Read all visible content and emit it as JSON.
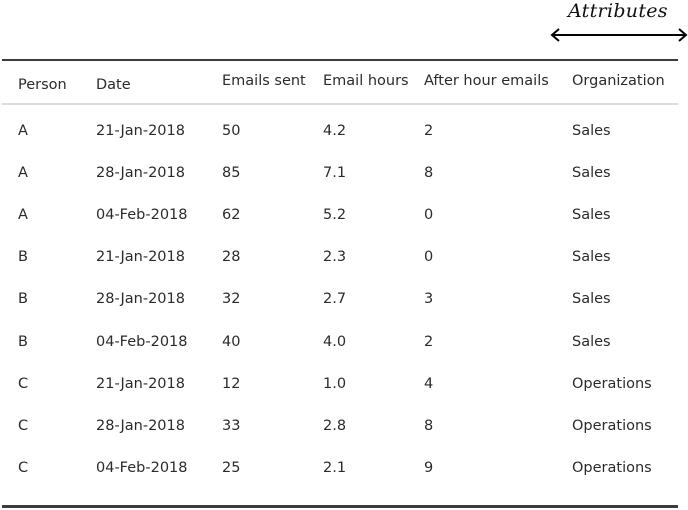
{
  "annotation": {
    "label": "Attributes",
    "arrow_icon": "double-headed-arrow-icon"
  },
  "table": {
    "headers": [
      "Person",
      "Date",
      "Emails sent",
      "Email hours",
      "After hour emails",
      "Organization"
    ],
    "rows": [
      [
        "A",
        "21-Jan-2018",
        "50",
        "4.2",
        "2",
        "Sales"
      ],
      [
        "A",
        "28-Jan-2018",
        "85",
        "7.1",
        "8",
        "Sales"
      ],
      [
        "A",
        "04-Feb-2018",
        "62",
        "5.2",
        "0",
        "Sales"
      ],
      [
        "B",
        "21-Jan-2018",
        "28",
        "2.3",
        "0",
        "Sales"
      ],
      [
        "B",
        "28-Jan-2018",
        "32",
        "2.7",
        "3",
        "Sales"
      ],
      [
        "B",
        "04-Feb-2018",
        "40",
        "4.0",
        "2",
        "Sales"
      ],
      [
        "C",
        "21-Jan-2018",
        "12",
        "1.0",
        "4",
        "Operations"
      ],
      [
        "C",
        "28-Jan-2018",
        "33",
        "2.8",
        "8",
        "Operations"
      ],
      [
        "C",
        "04-Feb-2018",
        "25",
        "2.1",
        "9",
        "Operations"
      ]
    ]
  }
}
